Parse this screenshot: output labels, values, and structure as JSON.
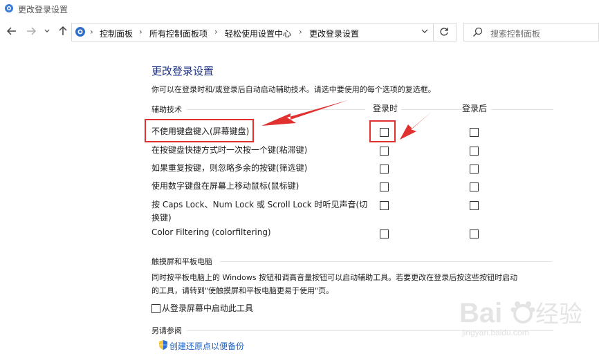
{
  "window": {
    "title": "更改登录设置"
  },
  "breadcrumbs": [
    "控制面板",
    "所有控制面板项",
    "轻松使用设置中心",
    "更改登录设置"
  ],
  "search": {
    "placeholder": "搜索控制面板"
  },
  "main": {
    "title": "更改登录设置",
    "description": "你可以在登录时和/或登录后自动启动辅助技术。请选中要使用的每个选项的复选框。",
    "assistive_group": "辅助技术",
    "col_login": "登录时",
    "col_after": "登录后",
    "options": [
      {
        "label": "不使用键盘键入(屏幕键盘)",
        "login": false,
        "after": false
      },
      {
        "label": "在按键盘快捷方式时一次按一个键(粘滞键)",
        "login": false,
        "after": false
      },
      {
        "label": "如果重复按键，则忽略多余的按键(筛选键)",
        "login": false,
        "after": false
      },
      {
        "label": "使用数字键盘在屏幕上移动鼠标(鼠标键)",
        "login": false,
        "after": false
      },
      {
        "label_line1": "按 Caps Lock、Num Lock 或 Scroll Lock 时听见声音(切",
        "label_line2": "换键)",
        "login": false,
        "after": false
      },
      {
        "label": "Color Filtering (colorfiltering)",
        "login": false,
        "after": false
      }
    ],
    "touch_group": "触摸屏和平板电脑",
    "touch_line1": "同时按平板电脑上的 Windows 按钮和调高音量按钮可以启动辅助工具。若要更改在登录后按这些按钮时启动",
    "touch_line2": "的工具，请转到\"使触摸屏和平板电脑更易于使用\"页。",
    "touch_checkbox": "从登录屏幕中启动此工具",
    "see_also_group": "另请参阅",
    "see_also_link": "创建还原点以便备份"
  },
  "watermark": {
    "brand": "Baidu经验",
    "url": "jingyan.baidu.com"
  },
  "colors": {
    "title_blue": "#1e3287",
    "link_blue": "#1e64c8",
    "annotation_red": "#e03030"
  },
  "icons": [
    "back-arrow-icon",
    "forward-arrow-icon",
    "recent-dropdown-icon",
    "up-arrow-icon",
    "control-panel-icon",
    "chevron-right-icon",
    "refresh-icon",
    "search-icon",
    "shield-icon"
  ]
}
